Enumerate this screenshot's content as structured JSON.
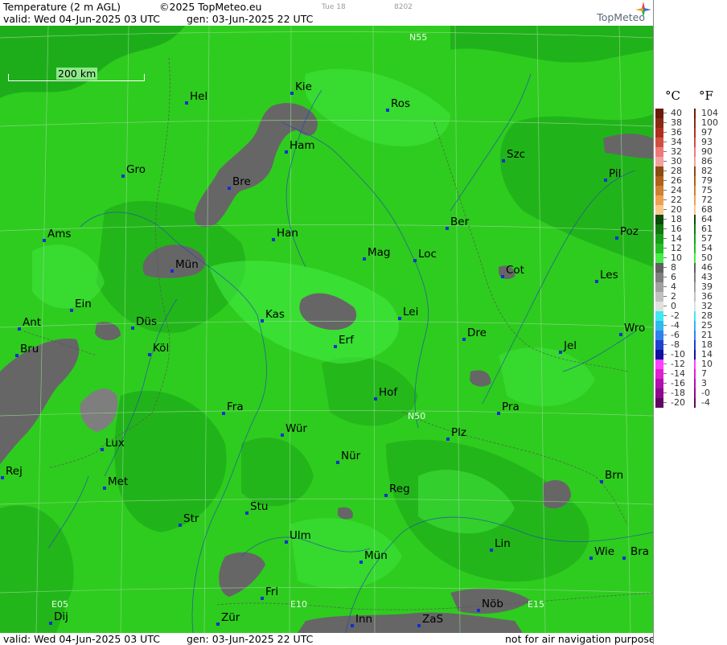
{
  "header": {
    "title": "Temperature (2 m AGL)",
    "copyright": "©2025 TopMeteo.eu",
    "day_code": "Tue 18",
    "code": "8202",
    "valid": "valid:  Wed  04-Jun-2025  03 UTC",
    "generated": "gen: 03-Jun-2025 22 UTC",
    "brand": "TopMeteo"
  },
  "footer": {
    "valid": "valid:  Wed  04-Jun-2025  03 UTC",
    "generated": "gen: 03-Jun-2025 22 UTC",
    "disclaimer": "not for air navigation purposes"
  },
  "scale": {
    "label": "200 km"
  },
  "grid_labels": [
    "N55",
    "N50",
    "E05",
    "E10",
    "E15"
  ],
  "legend": {
    "unit_c": "°C",
    "unit_f": "°F",
    "rows": [
      {
        "c": "40",
        "f": "104",
        "color": "#6b1a0c"
      },
      {
        "c": "38",
        "f": "100",
        "color": "#8a2a14"
      },
      {
        "c": "36",
        "f": "97",
        "color": "#b03020"
      },
      {
        "c": "34",
        "f": "93",
        "color": "#d05040"
      },
      {
        "c": "32",
        "f": "90",
        "color": "#f07878"
      },
      {
        "c": "30",
        "f": "86",
        "color": "#f4a0a0"
      },
      {
        "c": "28",
        "f": "82",
        "color": "#8a4a10"
      },
      {
        "c": "26",
        "f": "79",
        "color": "#b06018"
      },
      {
        "c": "24",
        "f": "75",
        "color": "#d08030"
      },
      {
        "c": "22",
        "f": "72",
        "color": "#f0a050"
      },
      {
        "c": "20",
        "f": "68",
        "color": "#f8c890"
      },
      {
        "c": "18",
        "f": "64",
        "color": "#0a4a0a"
      },
      {
        "c": "16",
        "f": "61",
        "color": "#107a10"
      },
      {
        "c": "14",
        "f": "57",
        "color": "#18a018"
      },
      {
        "c": "12",
        "f": "54",
        "color": "#22c022"
      },
      {
        "c": "10",
        "f": "50",
        "color": "#44ee44"
      },
      {
        "c": "8",
        "f": "46",
        "color": "#606060"
      },
      {
        "c": "6",
        "f": "43",
        "color": "#7e7e7e"
      },
      {
        "c": "4",
        "f": "39",
        "color": "#a0a0a0"
      },
      {
        "c": "2",
        "f": "36",
        "color": "#c0c0c0"
      },
      {
        "c": "0",
        "f": "32",
        "color": "#e0e0e0"
      },
      {
        "c": "-2",
        "f": "28",
        "color": "#40e8f0"
      },
      {
        "c": "-4",
        "f": "25",
        "color": "#30b8f0"
      },
      {
        "c": "-6",
        "f": "21",
        "color": "#3080f0"
      },
      {
        "c": "-8",
        "f": "18",
        "color": "#2040d0"
      },
      {
        "c": "-10",
        "f": "14",
        "color": "#1010a0"
      },
      {
        "c": "-12",
        "f": "10",
        "color": "#ff40ff"
      },
      {
        "c": "-14",
        "f": "7",
        "color": "#e020d0"
      },
      {
        "c": "-16",
        "f": "3",
        "color": "#b010b0"
      },
      {
        "c": "-18",
        "f": "-0",
        "color": "#900890"
      },
      {
        "c": "-20",
        "f": "-4",
        "color": "#600860"
      }
    ]
  },
  "cities": [
    {
      "name": "Kie"
    },
    {
      "name": "Hel"
    },
    {
      "name": "Ros"
    },
    {
      "name": "Ham"
    },
    {
      "name": "Szc"
    },
    {
      "name": "Gro"
    },
    {
      "name": "Bre"
    },
    {
      "name": "Pil"
    },
    {
      "name": "Ber"
    },
    {
      "name": "Ams"
    },
    {
      "name": "Han"
    },
    {
      "name": "Poz"
    },
    {
      "name": "Mag"
    },
    {
      "name": "Loc"
    },
    {
      "name": "Mün"
    },
    {
      "name": "Cot"
    },
    {
      "name": "Les"
    },
    {
      "name": "Ein"
    },
    {
      "name": "Kas"
    },
    {
      "name": "Lei"
    },
    {
      "name": "Ant"
    },
    {
      "name": "Düs"
    },
    {
      "name": "Dre"
    },
    {
      "name": "Wro"
    },
    {
      "name": "Köl"
    },
    {
      "name": "Erf"
    },
    {
      "name": "Jel"
    },
    {
      "name": "Bru"
    },
    {
      "name": "Hof"
    },
    {
      "name": "Fra"
    },
    {
      "name": "Pra"
    },
    {
      "name": "Wür"
    },
    {
      "name": "Plz"
    },
    {
      "name": "Lux"
    },
    {
      "name": "Nür"
    },
    {
      "name": "Rej"
    },
    {
      "name": "Met"
    },
    {
      "name": "Reg"
    },
    {
      "name": "Brn"
    },
    {
      "name": "Stu"
    },
    {
      "name": "Str"
    },
    {
      "name": "Ulm"
    },
    {
      "name": "Lin"
    },
    {
      "name": "Wie"
    },
    {
      "name": "Bra"
    },
    {
      "name": "Mün"
    },
    {
      "name": "Fri"
    },
    {
      "name": "Nöb"
    },
    {
      "name": "Dij"
    },
    {
      "name": "Zür"
    },
    {
      "name": "Inn"
    },
    {
      "name": "ZaS"
    }
  ],
  "colors": {
    "map_base": "#2ecc1e",
    "cool_patch": "#666666",
    "warm_patch": "#18a018",
    "bright_patch": "#44ee44",
    "city_dot": "#1030d0"
  }
}
